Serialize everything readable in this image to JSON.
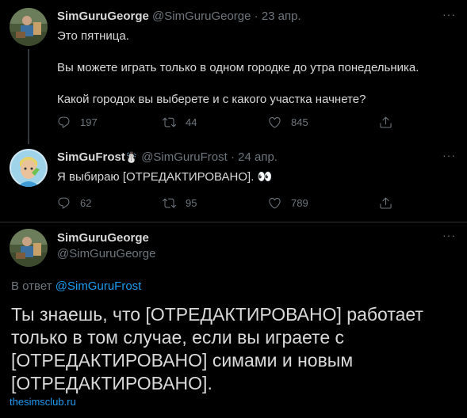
{
  "tweet1": {
    "display_name": "SimGuruGeorge",
    "handle": "@SimGuruGeorge",
    "separator": "·",
    "date": "23 апр.",
    "more": "···",
    "lines": [
      "Это пятница.",
      "Вы можете играть только в одном городке до утра понедельника.",
      "Какой городок вы выберете и с какого участка начнете?"
    ],
    "replies": "197",
    "retweets": "44",
    "likes": "845"
  },
  "tweet2": {
    "display_name": "SimGuFrost",
    "emoji": "☃️",
    "handle": "@SimGuruFrost",
    "separator": "·",
    "date": "24 апр.",
    "more": "···",
    "text": "Я выбираю [ОТРЕДАКТИРОВАНО].",
    "eyes": "👀",
    "replies": "62",
    "retweets": "95",
    "likes": "789"
  },
  "tweet3": {
    "display_name": "SimGuruGeorge",
    "handle": "@SimGuruGeorge",
    "more": "···",
    "reply_prefix": "В ответ",
    "reply_handle": "@SimGuruFrost",
    "lines": [
      "Ты знаешь, что [ОТРЕДАКТИРОВАНО] работает",
      "только в том случае, если вы играете с",
      "[ОТРЕДАКТИРОВАНО] симами и новым",
      "[ОТРЕДАКТИРОВАНО]."
    ]
  },
  "watermark": "thesimsclub.ru",
  "colors": {
    "background": "#000000",
    "accent": "#1d9bf0",
    "muted": "#6e767d"
  },
  "icons": [
    "reply-icon",
    "retweet-icon",
    "like-icon",
    "share-icon"
  ]
}
